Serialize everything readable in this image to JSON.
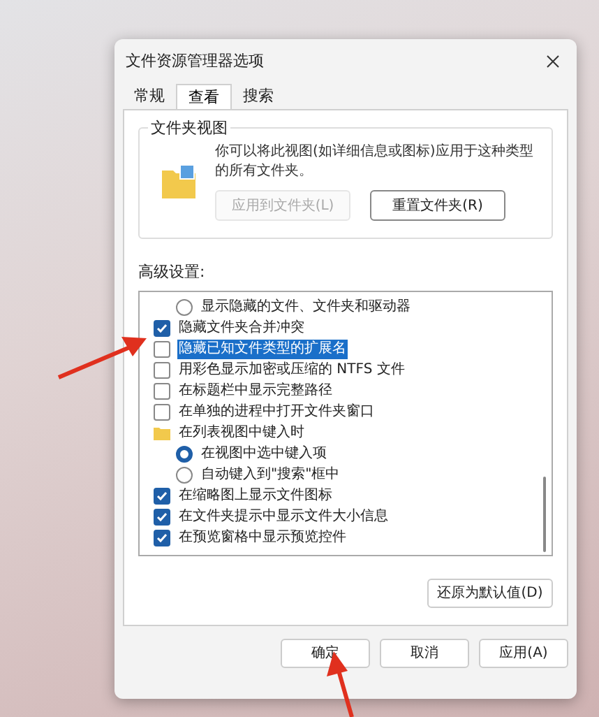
{
  "window": {
    "title": "文件资源管理器选项"
  },
  "tabs": [
    {
      "label": "常规",
      "selected": false
    },
    {
      "label": "查看",
      "selected": true
    },
    {
      "label": "搜索",
      "selected": false
    }
  ],
  "folder_views": {
    "title": "文件夹视图",
    "description": "你可以将此视图(如详细信息或图标)应用于这种类型的所有文件夹。",
    "buttons": [
      {
        "label": "应用到文件夹(L)",
        "disabled": true
      },
      {
        "label": "重置文件夹(R)",
        "disabled": false
      }
    ]
  },
  "advanced": {
    "title": "高级设置:",
    "items": [
      {
        "kind": "radio",
        "label": "显示隐藏的文件、文件夹和驱动器",
        "checked": false,
        "highlighted": false
      },
      {
        "kind": "checkbox",
        "label": "隐藏文件夹合并冲突",
        "checked": true,
        "highlighted": false
      },
      {
        "kind": "checkbox",
        "label": "隐藏已知文件类型的扩展名",
        "checked": false,
        "highlighted": true
      },
      {
        "kind": "checkbox",
        "label": "用彩色显示加密或压缩的 NTFS 文件",
        "checked": false,
        "highlighted": false
      },
      {
        "kind": "checkbox",
        "label": "在标题栏中显示完整路径",
        "checked": false,
        "highlighted": false
      },
      {
        "kind": "checkbox",
        "label": "在单独的进程中打开文件夹窗口",
        "checked": false,
        "highlighted": false
      },
      {
        "kind": "folder",
        "label": "在列表视图中键入时",
        "highlighted": false
      },
      {
        "kind": "radio",
        "label": "在视图中选中键入项",
        "checked": true,
        "highlighted": false
      },
      {
        "kind": "radio",
        "label": "自动键入到\"搜索\"框中",
        "checked": false,
        "highlighted": false
      },
      {
        "kind": "checkbox",
        "label": "在缩略图上显示文件图标",
        "checked": true,
        "highlighted": false
      },
      {
        "kind": "checkbox",
        "label": "在文件夹提示中显示文件大小信息",
        "checked": true,
        "highlighted": false
      },
      {
        "kind": "checkbox",
        "label": "在预览窗格中显示预览控件",
        "checked": true,
        "highlighted": false
      }
    ],
    "restore_button": "还原为默认值(D)"
  },
  "buttons": [
    "确定",
    "取消",
    "应用(A)"
  ]
}
